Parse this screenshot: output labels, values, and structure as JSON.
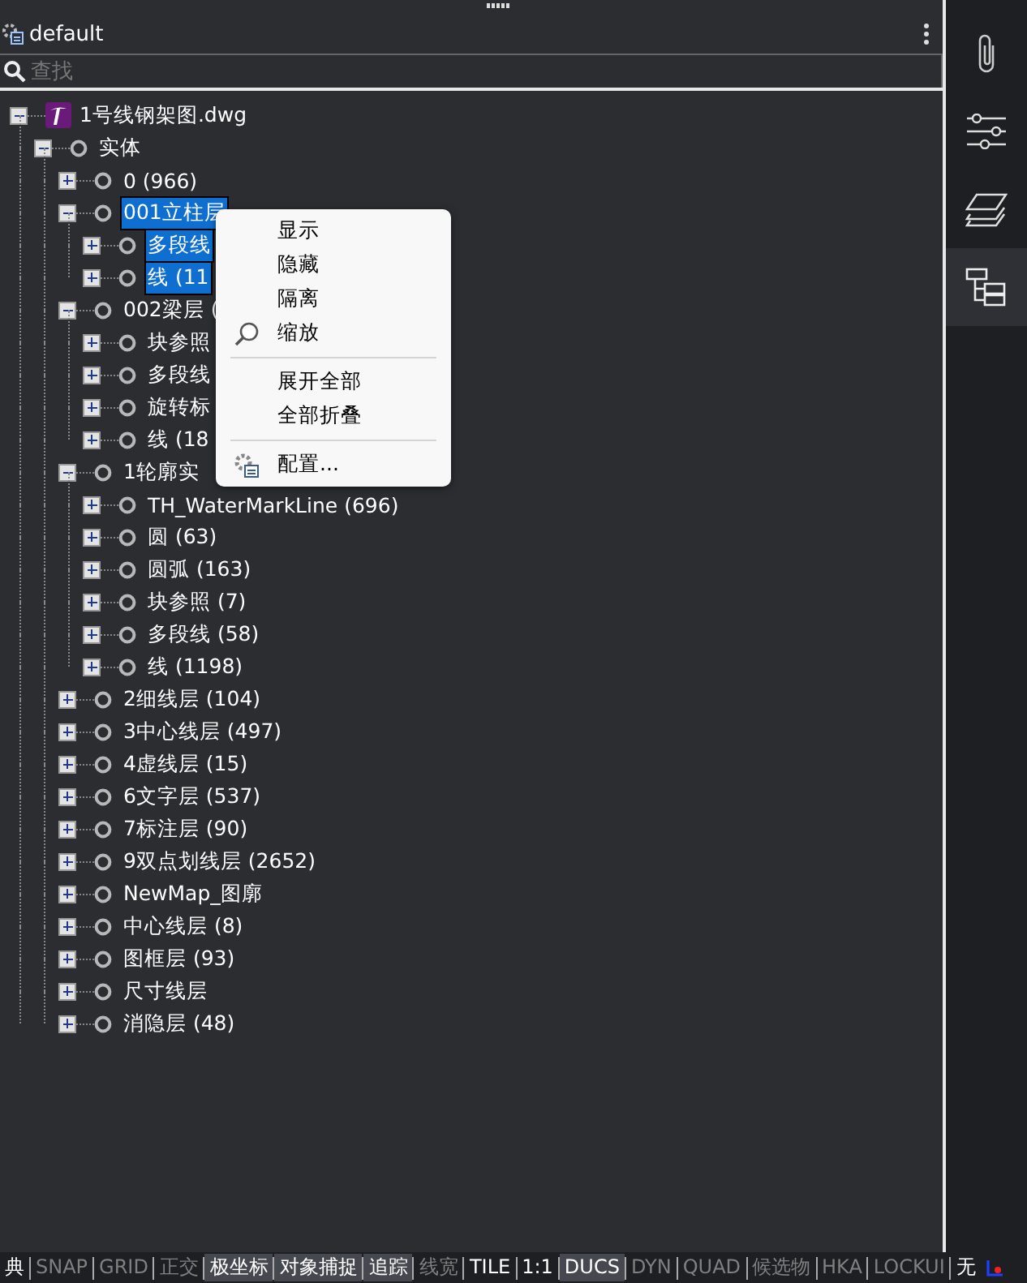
{
  "panel": {
    "title": "default"
  },
  "search": {
    "placeholder": "查找"
  },
  "tree": [
    {
      "label": "1号线钢架图.dwg",
      "kind": "file",
      "expanded": true,
      "selected": false,
      "children": [
        {
          "label": "实体",
          "expanded": true,
          "selected": false,
          "children": [
            {
              "label": "0 (966)",
              "expanded": false,
              "selected": false
            },
            {
              "label": "001立柱层",
              "expanded": true,
              "selected": true,
              "children": [
                {
                  "label": "多段线",
                  "expanded": false,
                  "selected": true
                },
                {
                  "label": "线 (11",
                  "expanded": false,
                  "selected": true
                }
              ]
            },
            {
              "label": "002梁层 (",
              "expanded": true,
              "selected": false,
              "children": [
                {
                  "label": "块参照",
                  "expanded": false,
                  "selected": false
                },
                {
                  "label": "多段线",
                  "expanded": false,
                  "selected": false
                },
                {
                  "label": "旋转标",
                  "expanded": false,
                  "selected": false
                },
                {
                  "label": "线 (18",
                  "expanded": false,
                  "selected": false
                }
              ]
            },
            {
              "label": "1轮廓实",
              "expanded": true,
              "selected": false,
              "children": [
                {
                  "label": "TH_WaterMarkLine (696)",
                  "expanded": false,
                  "selected": false
                },
                {
                  "label": "圆 (63)",
                  "expanded": false,
                  "selected": false
                },
                {
                  "label": "圆弧 (163)",
                  "expanded": false,
                  "selected": false
                },
                {
                  "label": "块参照 (7)",
                  "expanded": false,
                  "selected": false
                },
                {
                  "label": "多段线 (58)",
                  "expanded": false,
                  "selected": false
                },
                {
                  "label": "线 (1198)",
                  "expanded": false,
                  "selected": false
                }
              ]
            },
            {
              "label": "2细线层 (104)",
              "expanded": false,
              "selected": false
            },
            {
              "label": "3中心线层 (497)",
              "expanded": false,
              "selected": false
            },
            {
              "label": "4虚线层 (15)",
              "expanded": false,
              "selected": false
            },
            {
              "label": "6文字层 (537)",
              "expanded": false,
              "selected": false
            },
            {
              "label": "7标注层 (90)",
              "expanded": false,
              "selected": false
            },
            {
              "label": "9双点划线层 (2652)",
              "expanded": false,
              "selected": false
            },
            {
              "label": "NewMap_图廓",
              "expanded": false,
              "selected": false
            },
            {
              "label": "中心线层 (8)",
              "expanded": false,
              "selected": false
            },
            {
              "label": "图框层 (93)",
              "expanded": false,
              "selected": false
            },
            {
              "label": "尺寸线层",
              "expanded": false,
              "selected": false
            },
            {
              "label": "消隐层 (48)",
              "expanded": false,
              "selected": false
            }
          ]
        }
      ]
    }
  ],
  "context_menu": [
    {
      "label": "显示",
      "kind": "item"
    },
    {
      "label": "隐藏",
      "kind": "item"
    },
    {
      "label": "隔离",
      "kind": "item"
    },
    {
      "label": "缩放",
      "kind": "zoom"
    },
    {
      "kind": "separator"
    },
    {
      "label": "展开全部",
      "kind": "item"
    },
    {
      "label": "全部折叠",
      "kind": "item"
    },
    {
      "kind": "separator"
    },
    {
      "label": "配置...",
      "kind": "settings"
    }
  ],
  "sidebar": [
    {
      "kind": "attach",
      "selected": false
    },
    {
      "kind": "sliders",
      "selected": false
    },
    {
      "kind": "layers",
      "selected": false
    },
    {
      "kind": "tree",
      "selected": true
    }
  ],
  "status_bar": [
    {
      "label": "典",
      "on": true,
      "highlighted": false
    },
    {
      "label": "SNAP",
      "on": false,
      "highlighted": false
    },
    {
      "label": "GRID",
      "on": false,
      "highlighted": false
    },
    {
      "label": "正交",
      "on": false,
      "highlighted": false
    },
    {
      "label": "极坐标",
      "on": true,
      "highlighted": true
    },
    {
      "label": "对象捕捉",
      "on": true,
      "highlighted": true
    },
    {
      "label": "追踪",
      "on": true,
      "highlighted": true
    },
    {
      "label": "线宽",
      "on": false,
      "highlighted": false
    },
    {
      "label": "TILE",
      "on": true,
      "highlighted": false
    },
    {
      "label": "1:1",
      "on": true,
      "highlighted": false
    },
    {
      "label": "DUCS",
      "on": true,
      "highlighted": true
    },
    {
      "label": "DYN",
      "on": false,
      "highlighted": false
    },
    {
      "label": "QUAD",
      "on": false,
      "highlighted": false
    },
    {
      "label": "候选物",
      "on": false,
      "highlighted": false
    },
    {
      "label": "HKA",
      "on": false,
      "highlighted": false
    },
    {
      "label": "LOCKUI",
      "on": false,
      "highlighted": false
    },
    {
      "label": "无",
      "on": true,
      "highlighted": false
    }
  ]
}
